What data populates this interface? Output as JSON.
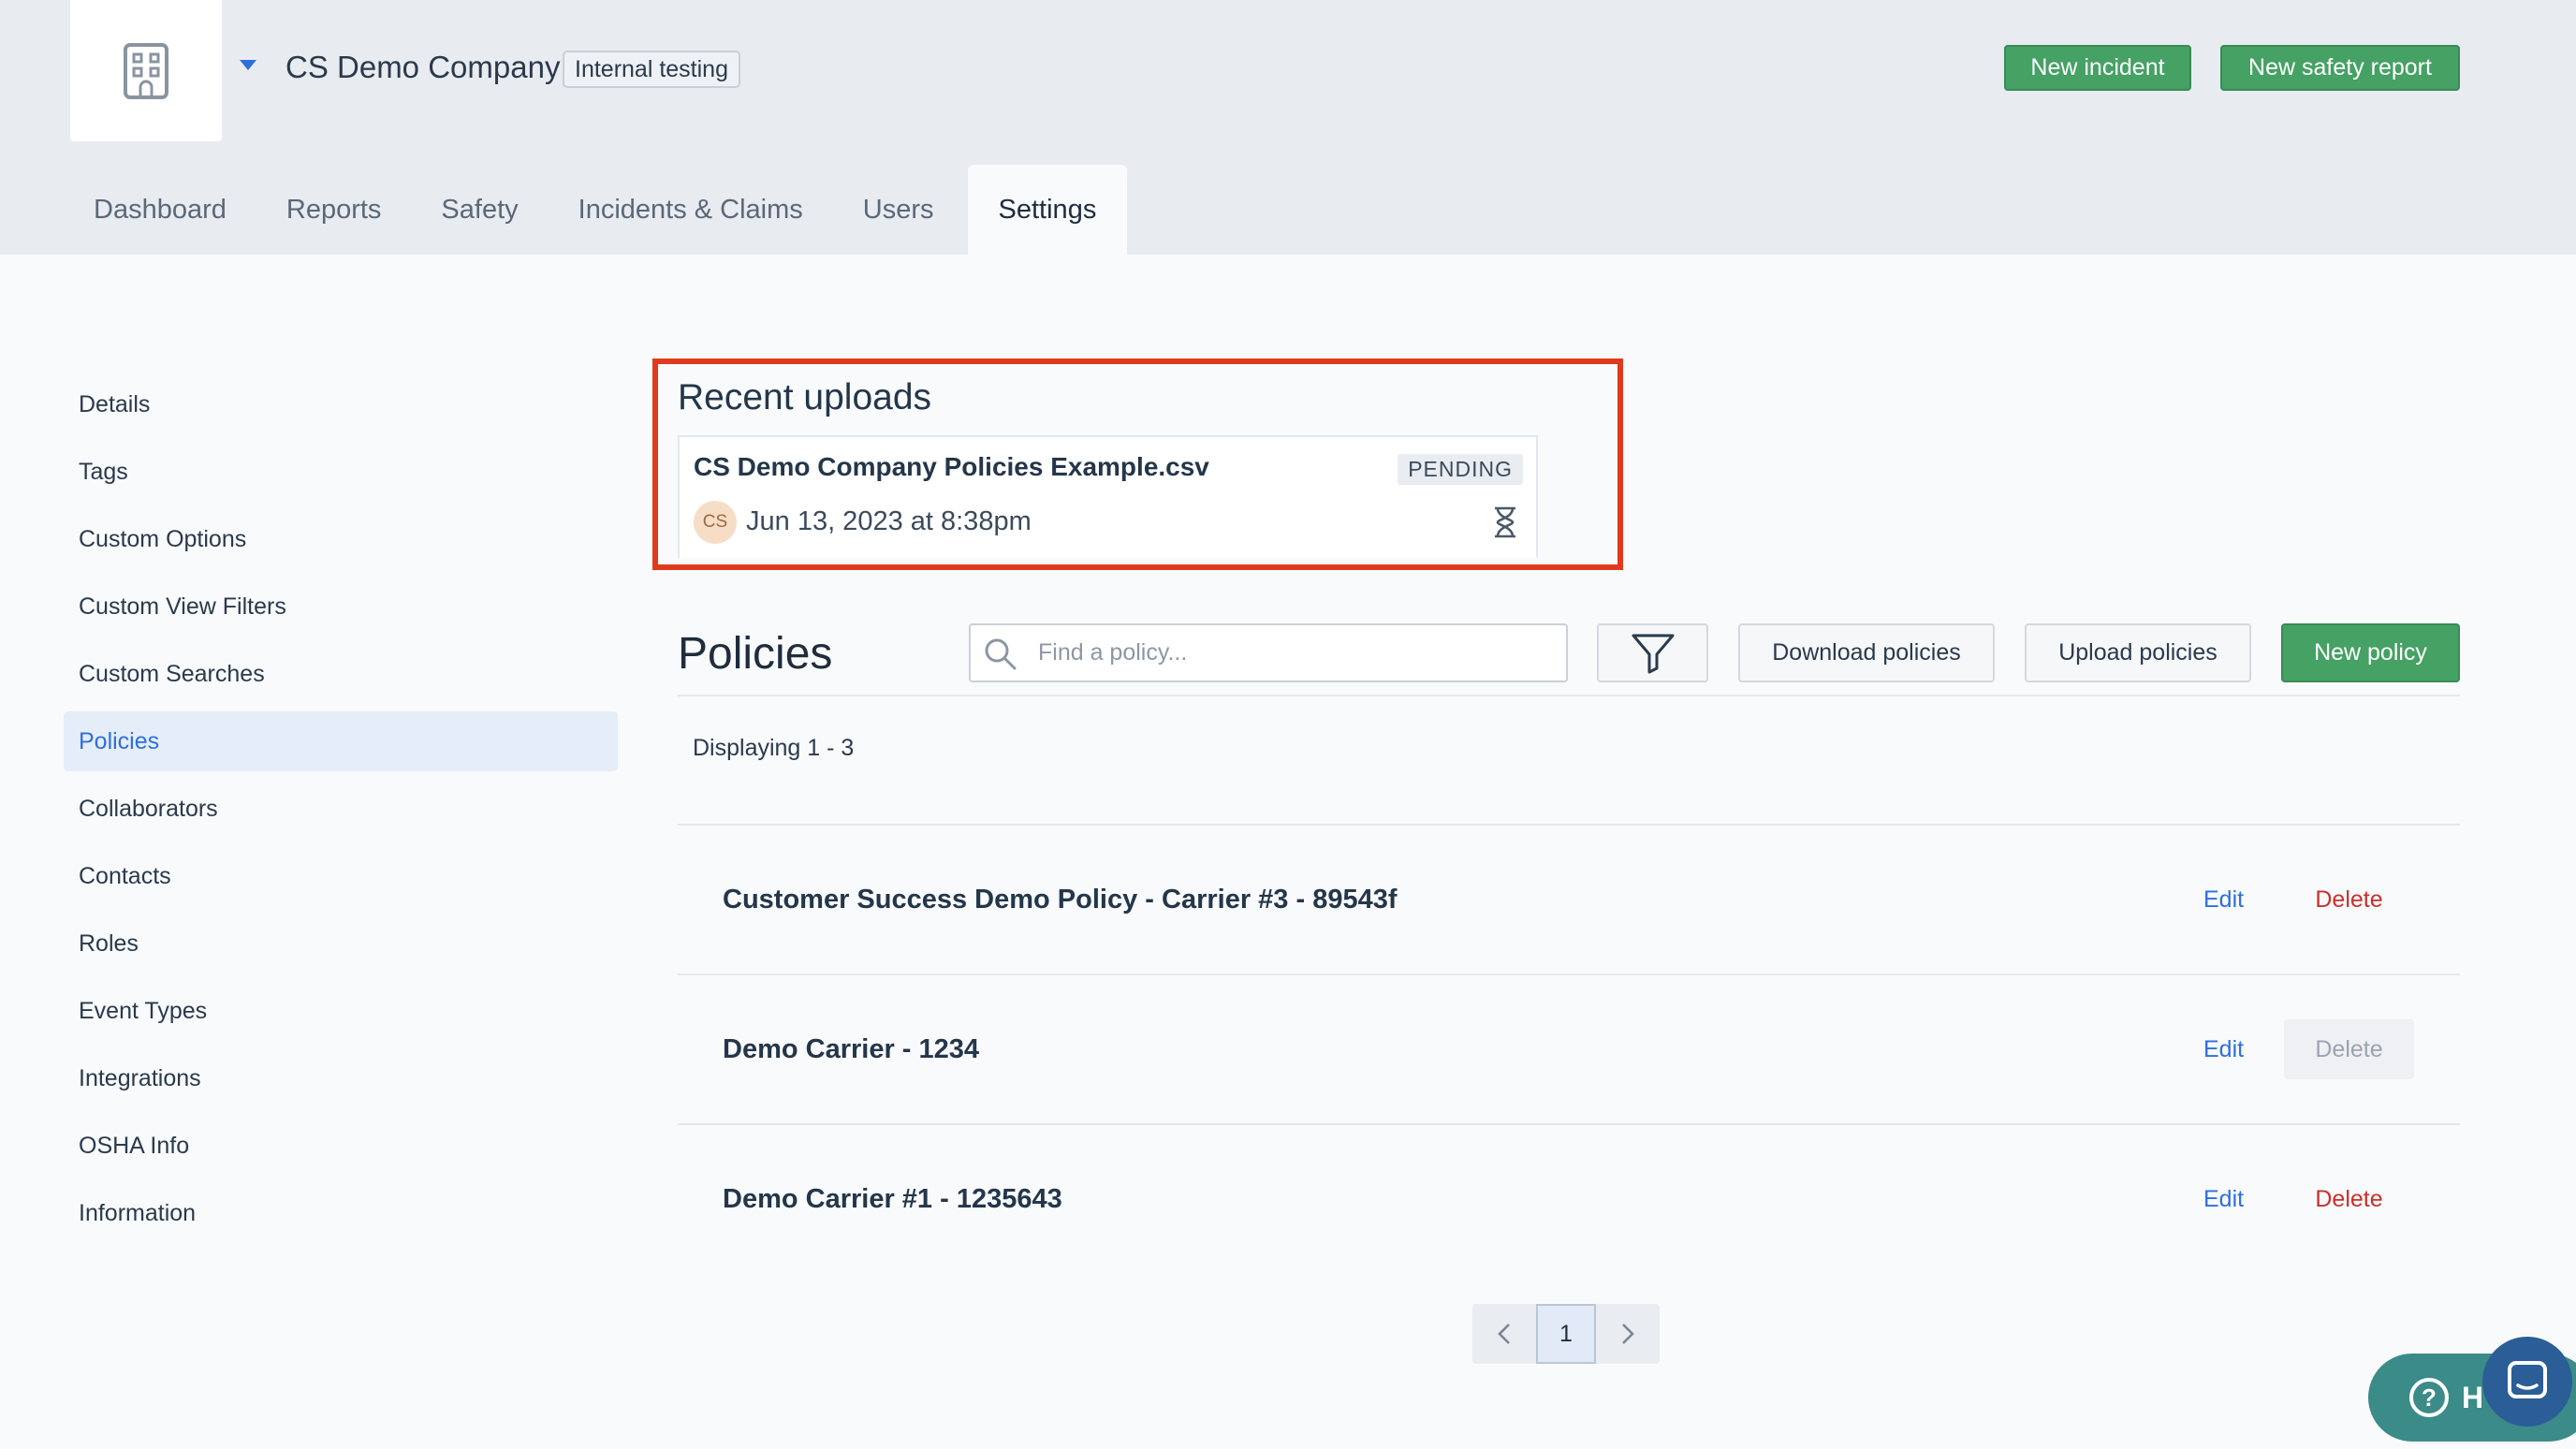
{
  "header": {
    "company_name": "CS Demo Company",
    "env_badge": "Internal testing",
    "new_incident_label": "New incident",
    "new_safety_report_label": "New safety report"
  },
  "tabs": [
    {
      "label": "Dashboard",
      "active": false
    },
    {
      "label": "Reports",
      "active": false
    },
    {
      "label": "Safety",
      "active": false
    },
    {
      "label": "Incidents & Claims",
      "active": false
    },
    {
      "label": "Users",
      "active": false
    },
    {
      "label": "Settings",
      "active": true
    }
  ],
  "sidebar": {
    "items": [
      {
        "label": "Details"
      },
      {
        "label": "Tags"
      },
      {
        "label": "Custom Options"
      },
      {
        "label": "Custom View Filters"
      },
      {
        "label": "Custom Searches"
      },
      {
        "label": "Policies",
        "active": true
      },
      {
        "label": "Collaborators"
      },
      {
        "label": "Contacts"
      },
      {
        "label": "Roles"
      },
      {
        "label": "Event Types"
      },
      {
        "label": "Integrations"
      },
      {
        "label": "OSHA Info"
      },
      {
        "label": "Information"
      }
    ]
  },
  "recent_uploads": {
    "title": "Recent uploads",
    "file_name": "CS Demo Company Policies Example.csv",
    "status": "PENDING",
    "avatar_initials": "CS",
    "timestamp": "Jun 13, 2023 at 8:38pm",
    "status_icon": "hourglass-icon"
  },
  "policies": {
    "title": "Policies",
    "search_placeholder": "Find a policy...",
    "download_label": "Download policies",
    "upload_label": "Upload policies",
    "new_label": "New policy",
    "displaying": "Displaying 1 - 3",
    "edit_label": "Edit",
    "delete_label": "Delete",
    "rows": [
      {
        "name": "Customer Success Demo Policy - Carrier #3 - 89543f",
        "delete_disabled": false
      },
      {
        "name": "Demo Carrier - 1234",
        "delete_disabled": true
      },
      {
        "name": "Demo Carrier #1 - 1235643",
        "delete_disabled": false
      }
    ]
  },
  "pagination": {
    "current_page": "1"
  },
  "help": {
    "label": "H"
  },
  "colors": {
    "accent_blue": "#2f6fdc",
    "primary_green": "#45a164",
    "danger_red": "#c9302c",
    "highlight_red": "#e03a1e"
  }
}
